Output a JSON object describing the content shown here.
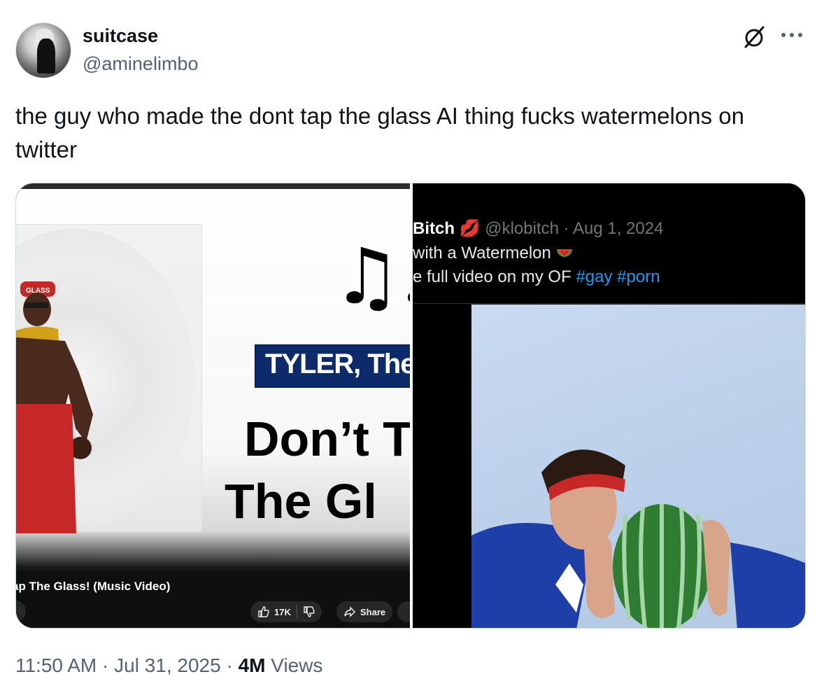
{
  "author": {
    "display_name": "suitcase",
    "handle": "@aminelimbo"
  },
  "tweet": {
    "text": "the guy who made the dont tap the glass AI thing fucks watermelons on twitter",
    "time": "11:50 AM",
    "date": "Jul 31, 2025",
    "views_count": "4M",
    "views_label": "Views",
    "separator": "·"
  },
  "media": {
    "left": {
      "banner": "TYLER, The C",
      "title_line1": "Don’t T",
      "title_line2": "The Gl",
      "video_title": "ap The Glass! (Music Video)",
      "like_count": "17K",
      "share_label": "Share",
      "cap_text": "GLASS"
    },
    "right": {
      "name": "Bitch",
      "handle_date": "@klobitch · Aug 1, 2024",
      "line2": "with a Watermelon",
      "line3_prefix": "e full video on my OF",
      "hashtags": [
        "#gay",
        "#porn"
      ]
    }
  },
  "colors": {
    "accent": "#1d9bf0",
    "secondary_text": "#536471",
    "banner_blue": "#0d2a6b"
  },
  "icons": [
    "grok-icon",
    "more-icon",
    "music-notes-icon",
    "lips-emoji-icon",
    "watermelon-emoji-icon",
    "thumbs-up-icon",
    "thumbs-down-icon",
    "share-arrow-icon"
  ]
}
